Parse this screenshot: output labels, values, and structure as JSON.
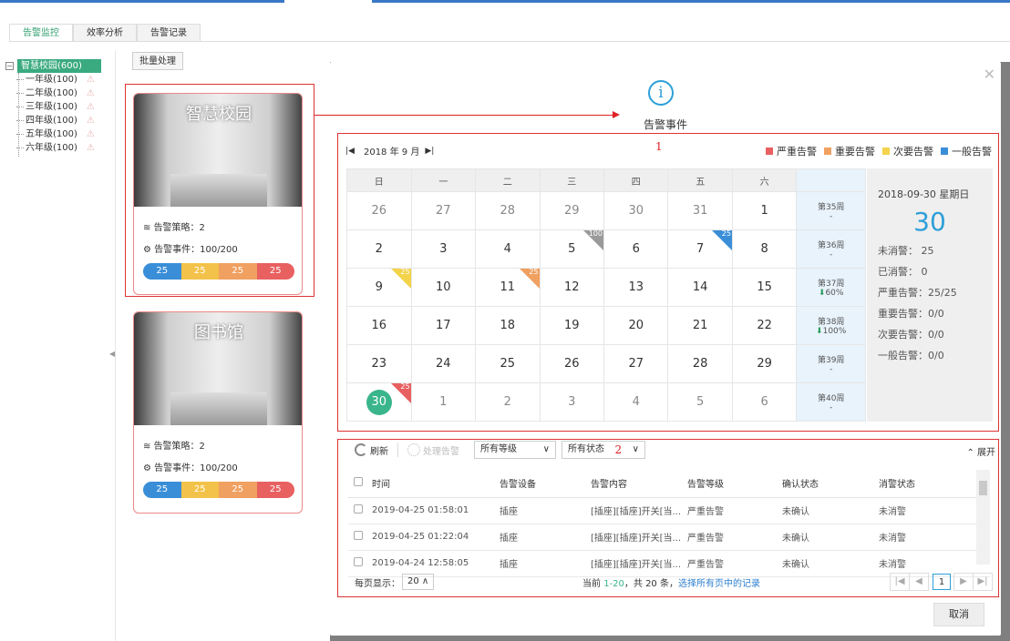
{
  "tabs": [
    "告警监控",
    "效率分析",
    "告警记录"
  ],
  "tree": {
    "root": "智慧校园(600)",
    "items": [
      "一年级(100)",
      "二年级(100)",
      "三年级(100)",
      "四年级(100)",
      "五年级(100)",
      "六年级(100)"
    ]
  },
  "batch_label": "批量处理",
  "cards": [
    {
      "title": "智慧校园",
      "policy": "告警策略：2",
      "events": "告警事件：100/200",
      "bar": [
        "25",
        "25",
        "25",
        "25"
      ]
    },
    {
      "title": "图书馆",
      "policy": "告警策略：2",
      "events": "告警事件：100/200",
      "bar": [
        "25",
        "25",
        "25",
        "25"
      ]
    }
  ],
  "modal": {
    "title": "告警事件",
    "month": "2018 年 9 月",
    "mark1": "1",
    "mark2": "2",
    "legend": [
      {
        "label": "严重告警",
        "color": "#e86060"
      },
      {
        "label": "重要告警",
        "color": "#f0a060"
      },
      {
        "label": "次要告警",
        "color": "#f3d34a"
      },
      {
        "label": "一般告警",
        "color": "#3a8ed8"
      }
    ],
    "weekdays": [
      "日",
      "一",
      "二",
      "三",
      "四",
      "五",
      "六"
    ],
    "weeks": [
      {
        "days": [
          "26",
          "27",
          "28",
          "29",
          "30",
          "31",
          "1"
        ],
        "label": "第35周",
        "sub": "-"
      },
      {
        "days": [
          "2",
          "3",
          "4",
          "5",
          "6",
          "7",
          "8"
        ],
        "label": "第36周",
        "sub": "-"
      },
      {
        "days": [
          "9",
          "10",
          "11",
          "12",
          "13",
          "14",
          "15"
        ],
        "label": "第37周",
        "sub": "60%"
      },
      {
        "days": [
          "16",
          "17",
          "18",
          "19",
          "20",
          "21",
          "22"
        ],
        "label": "第38周",
        "sub": "100%"
      },
      {
        "days": [
          "23",
          "24",
          "25",
          "26",
          "27",
          "28",
          "29"
        ],
        "label": "第39周",
        "sub": "-"
      },
      {
        "days": [
          "30",
          "1",
          "2",
          "3",
          "4",
          "5",
          "6"
        ],
        "label": "第40周",
        "sub": "-"
      }
    ],
    "badges": {
      "w1d3": "100",
      "w1d5": "25",
      "w2d0": "25",
      "w2d2": "25",
      "w5d0": "25"
    },
    "side": {
      "date": "2018-09-30  星期日",
      "day": "30",
      "rows": [
        "未消警：  25",
        "已消警：  0",
        "严重告警：25/25",
        "重要告警：0/0",
        "次要告警：0/0",
        "一般告警：0/0"
      ]
    },
    "toolbar": {
      "refresh": "刷新",
      "handle": "处理告警",
      "level": "所有等级",
      "status": "所有状态",
      "expand": "展开"
    },
    "columns": [
      "时间",
      "告警设备",
      "告警内容",
      "告警等级",
      "确认状态",
      "消警状态"
    ],
    "rows": [
      [
        "2019-04-25 01:58:01",
        "插座",
        "[插座][插座]开关[当...",
        "严重告警",
        "未确认",
        "未消警"
      ],
      [
        "2019-04-25 01:22:04",
        "插座",
        "[插座][插座]开关[当...",
        "严重告警",
        "未确认",
        "未消警"
      ],
      [
        "2019-04-24 12:58:05",
        "插座",
        "[插座][插座]开关[当...",
        "严重告警",
        "未确认",
        "未消警"
      ]
    ],
    "pager": {
      "per_page_label": "每页显示：",
      "per_page": "20",
      "prefix": "当前 ",
      "range": "1-20",
      "total": "，共 20 条，",
      "select_all": "选择所有页中的记录",
      "page": "1"
    },
    "cancel": "取消"
  }
}
